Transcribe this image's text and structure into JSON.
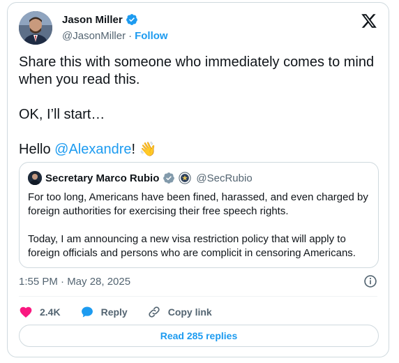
{
  "author": {
    "name": "Jason Miller",
    "handle": "@JasonMiller",
    "separator": "·",
    "follow_label": "Follow"
  },
  "tweet": {
    "line1": "Share this with someone who immediately comes to mind when you read this.",
    "line2": "OK, I’ll start…",
    "hello_prefix": "Hello ",
    "mention": "@Alexandre",
    "hello_suffix": "!",
    "emoji": "👋"
  },
  "quote": {
    "name": "Secretary Marco Rubio",
    "handle": "@SecRubio",
    "para1": "For too long, Americans have been fined, harassed, and even charged by foreign authorities for exercising their free speech rights.",
    "para2": "Today, I am announcing a new visa restriction policy that will apply to foreign officials and persons who are complicit in censoring Americans."
  },
  "meta": {
    "timestamp": "1:55 PM · May 28, 2025"
  },
  "actions": {
    "likes": "2.4K",
    "reply_label": "Reply",
    "copy_label": "Copy link"
  },
  "read_replies_label": "Read 285 replies",
  "colors": {
    "accent": "#1d9bf0",
    "like": "#f91880",
    "text": "#0f1419",
    "muted": "#536471",
    "border": "#cfd9de"
  },
  "icons": [
    "verified-badge-icon",
    "x-logo-icon",
    "waving-hand-emoji",
    "seal-icon",
    "info-icon",
    "heart-icon",
    "reply-bubble-icon",
    "link-icon"
  ]
}
